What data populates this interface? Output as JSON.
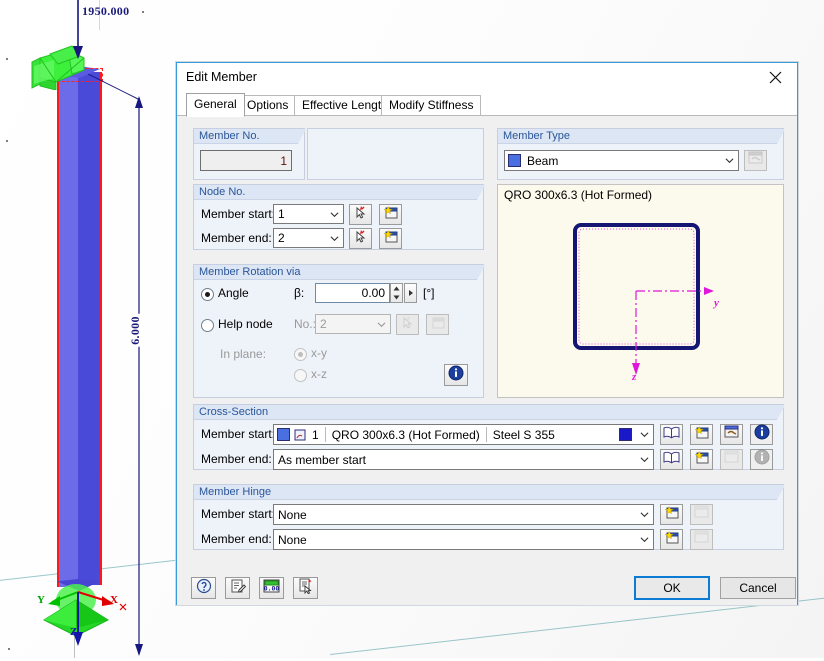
{
  "viewport": {
    "load_value": "1950.000",
    "dimension_value": "6.000",
    "axes": {
      "x": "X",
      "y": "Y",
      "z": "Z"
    }
  },
  "dialog": {
    "title": "Edit Member",
    "close_label": "Close",
    "tabs": [
      {
        "label": "General",
        "active": true
      },
      {
        "label": "Options",
        "active": false
      },
      {
        "label": "Effective Lengths",
        "active": false
      },
      {
        "label": "Modify Stiffness",
        "active": false
      }
    ],
    "member_no": {
      "group": "Member No.",
      "value": "1"
    },
    "member_type": {
      "group": "Member Type",
      "value": "Beam",
      "swatch_color": "#4a6fe0",
      "edit_icon": "edit-window-icon"
    },
    "node_no": {
      "group": "Node No.",
      "start_label": "Member start:",
      "start_value": "1",
      "end_label": "Member end:",
      "end_value": "2",
      "pick_icon": "pick-cursor-icon",
      "new_icon": "new-window-icon"
    },
    "rotation": {
      "group": "Member Rotation via",
      "angle_label": "Angle",
      "angle_selected": true,
      "beta_label": "β:",
      "beta_value": "0.00",
      "beta_unit": "[°]",
      "helpnode_label": "Help node",
      "helpnode_selected": false,
      "no_label": "No.:",
      "no_value": "2",
      "inplane_label": "In plane:",
      "inplane_xy": "x-y",
      "inplane_xz": "x-z",
      "inplane_selected": "x-y",
      "info_icon": "info-icon"
    },
    "cross_section_preview": {
      "caption": "QRO 300x6.3 (Hot Formed)",
      "axis_y": "y",
      "axis_z": "z",
      "outline_color": "#151573",
      "axis_color": "#e016d8",
      "background": "#fbfaec"
    },
    "cross_section": {
      "group": "Cross-Section",
      "start_label": "Member start:",
      "start_no": "1",
      "start_section": "QRO 300x6.3 (Hot Formed)",
      "start_material": "Steel S 355",
      "start_swatch": "#4a6fe0",
      "start_color2": "#1919c8",
      "end_label": "Member end:",
      "end_value": "As member start",
      "icons": [
        "library-icon",
        "new-window-icon",
        "edit-window-icon",
        "info-icon"
      ]
    },
    "member_hinge": {
      "group": "Member Hinge",
      "start_label": "Member start:",
      "start_value": "None",
      "end_label": "Member end:",
      "end_value": "None",
      "icons": [
        "new-window-icon",
        "edit-window-icon"
      ]
    },
    "footer": {
      "tools": [
        "help-icon",
        "comment-icon",
        "calculator-icon",
        "pick-document-icon"
      ],
      "ok_label": "OK",
      "cancel_label": "Cancel"
    }
  }
}
